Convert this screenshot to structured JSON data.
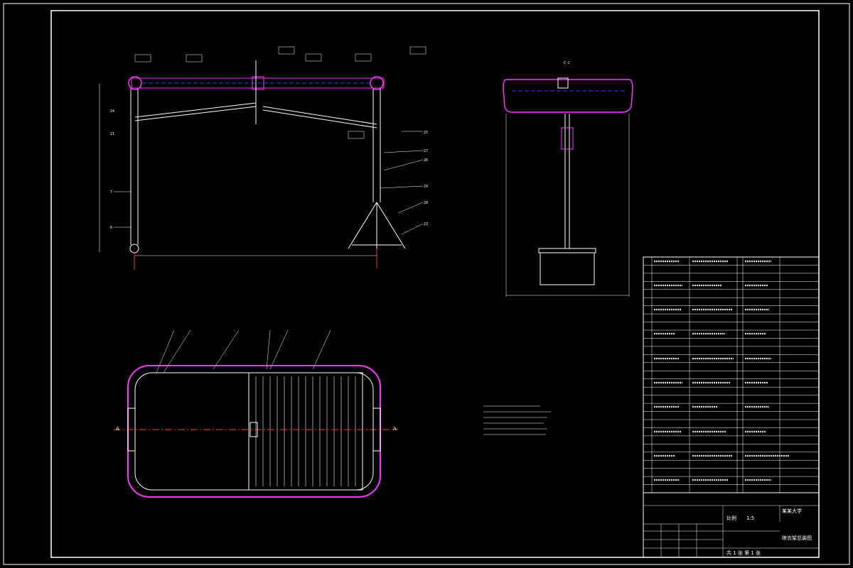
{
  "scale": {
    "label": "比例",
    "value": "1:5"
  },
  "drawing_title": "晾衣架总装图",
  "school": "某某大学",
  "sheet": "共 1 张 第 1 张",
  "bom_rows": 29,
  "view_label_side": "C-C",
  "section_labels": {
    "left": "A",
    "right": "A"
  },
  "colors": {
    "bg": "#000000",
    "line": "#ffffff",
    "magenta": "#ff33ff",
    "blue": "#3344ff",
    "red": "#ff3333"
  }
}
